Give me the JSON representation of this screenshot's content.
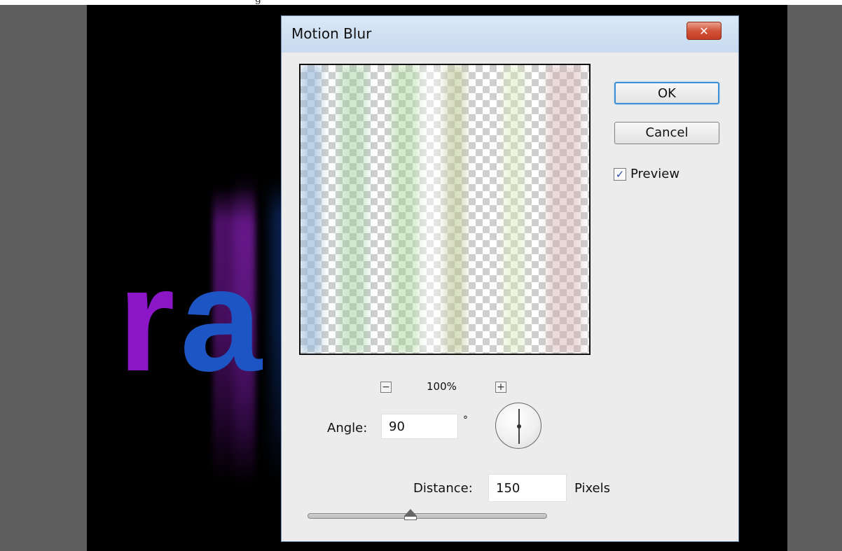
{
  "app": {
    "top_strip_text": "g"
  },
  "dialog": {
    "title": "Motion Blur",
    "close_glyph": "✕",
    "zoom": {
      "level": "100%",
      "out_glyph": "−",
      "in_glyph": "+"
    },
    "buttons": {
      "ok": "OK",
      "cancel": "Cancel"
    },
    "preview": {
      "label": "Preview",
      "checked": true,
      "check_glyph": "✓"
    },
    "angle": {
      "label": "Angle:",
      "value": "90",
      "unit": "°"
    },
    "distance": {
      "label": "Distance:",
      "value": "150",
      "unit": "Pixels",
      "slider_fraction": 0.43
    }
  },
  "canvas": {
    "letters": [
      "r",
      "a"
    ],
    "colors": {
      "letter_r": "#8a16c8",
      "letter_a": "#1d56c4",
      "accent_red": "#c81428",
      "background": "#000000"
    }
  },
  "icons": {
    "close": "close-icon",
    "zoom_out": "zoom-out-icon",
    "zoom_in": "zoom-in-icon",
    "dial": "angle-dial-icon",
    "check": "checkmark-icon"
  }
}
